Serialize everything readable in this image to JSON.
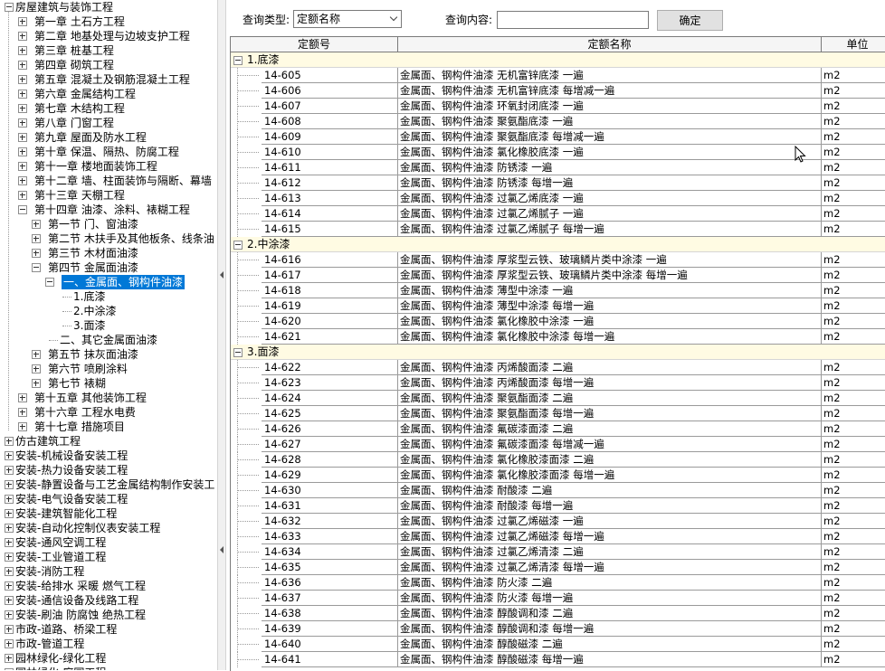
{
  "tree": {
    "items": [
      {
        "label": "房屋建筑与装饰工程",
        "level": 0,
        "box": "minus"
      },
      {
        "label": "第一章 土石方工程",
        "level": 1,
        "box": "plus"
      },
      {
        "label": "第二章 地基处理与边坡支护工程",
        "level": 1,
        "box": "plus"
      },
      {
        "label": "第三章 桩基工程",
        "level": 1,
        "box": "plus"
      },
      {
        "label": "第四章 砌筑工程",
        "level": 1,
        "box": "plus"
      },
      {
        "label": "第五章 混凝土及钢筋混凝土工程",
        "level": 1,
        "box": "plus"
      },
      {
        "label": "第六章 金属结构工程",
        "level": 1,
        "box": "plus"
      },
      {
        "label": "第七章 木结构工程",
        "level": 1,
        "box": "plus"
      },
      {
        "label": "第八章 门窗工程",
        "level": 1,
        "box": "plus"
      },
      {
        "label": "第九章 屋面及防水工程",
        "level": 1,
        "box": "plus"
      },
      {
        "label": "第十章 保温、隔热、防腐工程",
        "level": 1,
        "box": "plus"
      },
      {
        "label": "第十一章 楼地面装饰工程",
        "level": 1,
        "box": "plus"
      },
      {
        "label": "第十二章 墙、柱面装饰与隔断、幕墙",
        "level": 1,
        "box": "plus"
      },
      {
        "label": "第十三章 天棚工程",
        "level": 1,
        "box": "plus"
      },
      {
        "label": "第十四章 油漆、涂料、裱糊工程",
        "level": 1,
        "box": "minus"
      },
      {
        "label": "第一节 门、窗油漆",
        "level": 2,
        "box": "plus"
      },
      {
        "label": "第二节 木扶手及其他板条、线条油",
        "level": 2,
        "box": "plus"
      },
      {
        "label": "第三节 木材面油漆",
        "level": 2,
        "box": "plus"
      },
      {
        "label": "第四节 金属面油漆",
        "level": 2,
        "box": "minus"
      },
      {
        "label": "一、金属面、钢构件油漆",
        "level": 3,
        "box": "minus",
        "selected": true
      },
      {
        "label": "1.底漆",
        "level": 4,
        "box": "none"
      },
      {
        "label": "2.中涂漆",
        "level": 4,
        "box": "none"
      },
      {
        "label": "3.面漆",
        "level": 4,
        "box": "none"
      },
      {
        "label": "二、其它金属面油漆",
        "level": 3,
        "box": "none"
      },
      {
        "label": "第五节 抹灰面油漆",
        "level": 2,
        "box": "plus"
      },
      {
        "label": "第六节 喷刷涂料",
        "level": 2,
        "box": "plus"
      },
      {
        "label": "第七节 裱糊",
        "level": 2,
        "box": "plus"
      },
      {
        "label": "第十五章 其他装饰工程",
        "level": 1,
        "box": "plus"
      },
      {
        "label": "第十六章 工程水电费",
        "level": 1,
        "box": "plus"
      },
      {
        "label": "第十七章 措施项目",
        "level": 1,
        "box": "plus"
      },
      {
        "label": "仿古建筑工程",
        "level": 0,
        "box": "plus"
      },
      {
        "label": "安装-机械设备安装工程",
        "level": 0,
        "box": "plus"
      },
      {
        "label": "安装-热力设备安装工程",
        "level": 0,
        "box": "plus"
      },
      {
        "label": "安装-静置设备与工艺金属结构制作安装工",
        "level": 0,
        "box": "plus"
      },
      {
        "label": "安装-电气设备安装工程",
        "level": 0,
        "box": "plus"
      },
      {
        "label": "安装-建筑智能化工程",
        "level": 0,
        "box": "plus"
      },
      {
        "label": "安装-自动化控制仪表安装工程",
        "level": 0,
        "box": "plus"
      },
      {
        "label": "安装-通风空调工程",
        "level": 0,
        "box": "plus"
      },
      {
        "label": "安装-工业管道工程",
        "level": 0,
        "box": "plus"
      },
      {
        "label": "安装-消防工程",
        "level": 0,
        "box": "plus"
      },
      {
        "label": "安装-给排水 采暖 燃气工程",
        "level": 0,
        "box": "plus"
      },
      {
        "label": "安装-通信设备及线路工程",
        "level": 0,
        "box": "plus"
      },
      {
        "label": "安装-刷油 防腐蚀 绝热工程",
        "level": 0,
        "box": "plus"
      },
      {
        "label": "市政-道路、桥梁工程",
        "level": 0,
        "box": "plus"
      },
      {
        "label": "市政-管道工程",
        "level": 0,
        "box": "plus"
      },
      {
        "label": "园林绿化-绿化工程",
        "level": 0,
        "box": "plus"
      },
      {
        "label": "园林绿化-庭园工程",
        "level": 0,
        "box": "plus"
      }
    ]
  },
  "query": {
    "type_label": "查询类型:",
    "type_value": "定额名称",
    "content_label": "查询内容:",
    "content_value": "",
    "confirm_label": "确定"
  },
  "grid": {
    "columns": [
      "定额号",
      "定额名称",
      "单位"
    ],
    "groups": [
      {
        "label": "1.底漆",
        "rows": [
          [
            "14-605",
            "金属面、钢构件油漆 无机富锌底漆 一遍",
            "m2"
          ],
          [
            "14-606",
            "金属面、钢构件油漆 无机富锌底漆 每增减一遍",
            "m2"
          ],
          [
            "14-607",
            "金属面、钢构件油漆 环氧封闭底漆 一遍",
            "m2"
          ],
          [
            "14-608",
            "金属面、钢构件油漆 聚氨酯底漆 一遍",
            "m2"
          ],
          [
            "14-609",
            "金属面、钢构件油漆 聚氨酯底漆 每增减一遍",
            "m2"
          ],
          [
            "14-610",
            "金属面、钢构件油漆 氯化橡胶底漆 一遍",
            "m2"
          ],
          [
            "14-611",
            "金属面、钢构件油漆 防锈漆 一遍",
            "m2"
          ],
          [
            "14-612",
            "金属面、钢构件油漆 防锈漆 每增一遍",
            "m2"
          ],
          [
            "14-613",
            "金属面、钢构件油漆 过氯乙烯底漆 一遍",
            "m2"
          ],
          [
            "14-614",
            "金属面、钢构件油漆 过氯乙烯腻子 一遍",
            "m2"
          ],
          [
            "14-615",
            "金属面、钢构件油漆 过氯乙烯腻子 每增一遍",
            "m2"
          ]
        ]
      },
      {
        "label": "2.中涂漆",
        "rows": [
          [
            "14-616",
            "金属面、钢构件油漆 厚浆型云铁、玻璃鳞片类中涂漆 一遍",
            "m2"
          ],
          [
            "14-617",
            "金属面、钢构件油漆 厚浆型云铁、玻璃鳞片类中涂漆 每增一遍",
            "m2"
          ],
          [
            "14-618",
            "金属面、钢构件油漆 薄型中涂漆 一遍",
            "m2"
          ],
          [
            "14-619",
            "金属面、钢构件油漆 薄型中涂漆 每增一遍",
            "m2"
          ],
          [
            "14-620",
            "金属面、钢构件油漆 氯化橡胶中涂漆 一遍",
            "m2"
          ],
          [
            "14-621",
            "金属面、钢构件油漆 氯化橡胶中涂漆 每增一遍",
            "m2"
          ]
        ]
      },
      {
        "label": "3.面漆",
        "rows": [
          [
            "14-622",
            "金属面、钢构件油漆 丙烯酸面漆 二遍",
            "m2"
          ],
          [
            "14-623",
            "金属面、钢构件油漆 丙烯酸面漆 每增一遍",
            "m2"
          ],
          [
            "14-624",
            "金属面、钢构件油漆 聚氨酯面漆 二遍",
            "m2"
          ],
          [
            "14-625",
            "金属面、钢构件油漆 聚氨酯面漆 每增一遍",
            "m2"
          ],
          [
            "14-626",
            "金属面、钢构件油漆 氟碳漆面漆 二遍",
            "m2"
          ],
          [
            "14-627",
            "金属面、钢构件油漆 氟碳漆面漆 每增减一遍",
            "m2"
          ],
          [
            "14-628",
            "金属面、钢构件油漆 氯化橡胶漆面漆 二遍",
            "m2"
          ],
          [
            "14-629",
            "金属面、钢构件油漆 氯化橡胶漆面漆 每增一遍",
            "m2"
          ],
          [
            "14-630",
            "金属面、钢构件油漆 耐酸漆 二遍",
            "m2"
          ],
          [
            "14-631",
            "金属面、钢构件油漆 耐酸漆 每增一遍",
            "m2"
          ],
          [
            "14-632",
            "金属面、钢构件油漆 过氯乙烯磁漆 一遍",
            "m2"
          ],
          [
            "14-633",
            "金属面、钢构件油漆 过氯乙烯磁漆 每增一遍",
            "m2"
          ],
          [
            "14-634",
            "金属面、钢构件油漆 过氯乙烯清漆 二遍",
            "m2"
          ],
          [
            "14-635",
            "金属面、钢构件油漆 过氯乙烯清漆 每增一遍",
            "m2"
          ],
          [
            "14-636",
            "金属面、钢构件油漆 防火漆 二遍",
            "m2"
          ],
          [
            "14-637",
            "金属面、钢构件油漆 防火漆 每增一遍",
            "m2"
          ],
          [
            "14-638",
            "金属面、钢构件油漆 醇酸调和漆 二遍",
            "m2"
          ],
          [
            "14-639",
            "金属面、钢构件油漆 醇酸调和漆 每增一遍",
            "m2"
          ],
          [
            "14-640",
            "金属面、钢构件油漆 醇酸磁漆 二遍",
            "m2"
          ],
          [
            "14-641",
            "金属面、钢构件油漆 醇酸磁漆 每增一遍",
            "m2"
          ]
        ]
      }
    ]
  }
}
